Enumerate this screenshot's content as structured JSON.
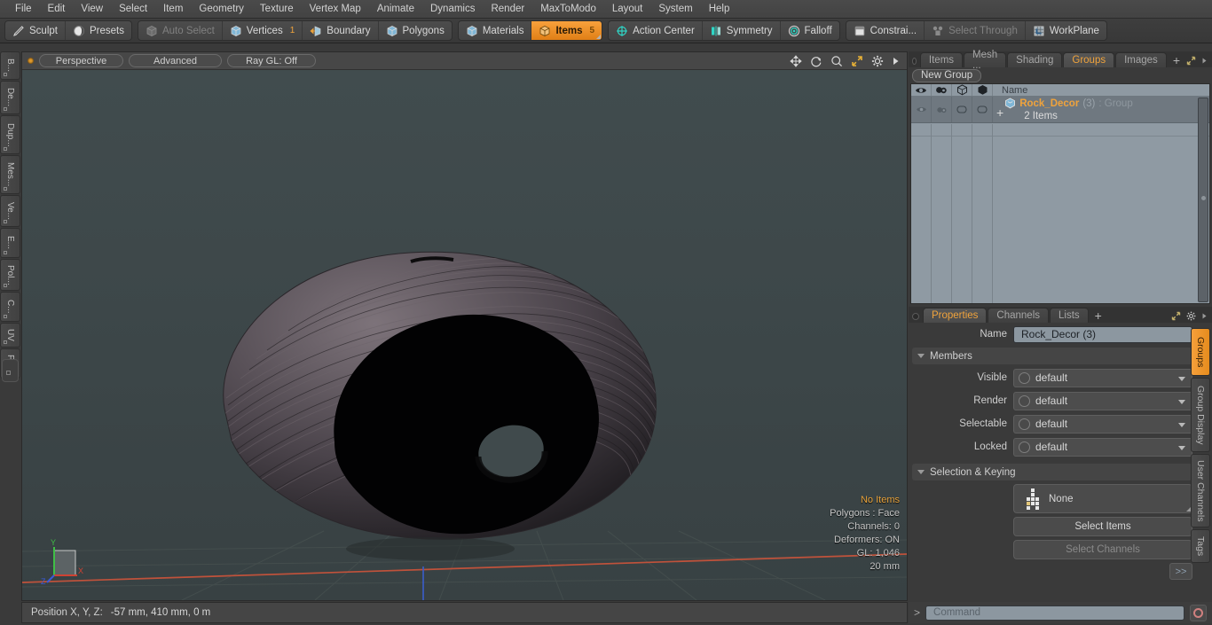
{
  "menu": {
    "items": [
      "File",
      "Edit",
      "View",
      "Select",
      "Item",
      "Geometry",
      "Texture",
      "Vertex Map",
      "Animate",
      "Dynamics",
      "Render",
      "MaxToModo",
      "Layout",
      "System",
      "Help"
    ]
  },
  "toolbar": {
    "groups": [
      {
        "buttons": [
          {
            "label": "Sculpt",
            "icon": "pencil-icon",
            "state": "normal"
          },
          {
            "label": "Presets",
            "icon": "sphere-icon",
            "state": "normal"
          }
        ]
      },
      {
        "buttons": [
          {
            "label": "Auto Select",
            "icon": "cube-grey-icon",
            "state": "disabled"
          },
          {
            "label": "Vertices",
            "icon": "cube-blue-icon",
            "state": "normal",
            "badge": "1"
          },
          {
            "label": "Boundary",
            "icon": "arrow-cube-icon",
            "state": "normal"
          },
          {
            "label": "Polygons",
            "icon": "cube-blue-icon",
            "state": "normal"
          }
        ]
      },
      {
        "buttons": [
          {
            "label": "Materials",
            "icon": "cube-blue-icon",
            "state": "normal"
          },
          {
            "label": "Items",
            "icon": "cube-orange-icon",
            "state": "active",
            "badge": "5"
          }
        ]
      },
      {
        "buttons": [
          {
            "label": "Action Center",
            "icon": "crosshair-icon",
            "state": "normal"
          },
          {
            "label": "Symmetry",
            "icon": "mirror-icon",
            "state": "normal"
          },
          {
            "label": "Falloff",
            "icon": "target-icon",
            "state": "normal"
          }
        ]
      },
      {
        "buttons": [
          {
            "label": "Constrai...",
            "icon": "constraint-icon",
            "state": "normal"
          },
          {
            "label": "Select Through",
            "icon": "through-icon",
            "state": "disabled"
          },
          {
            "label": "WorkPlane",
            "icon": "workplane-icon",
            "state": "normal"
          }
        ]
      }
    ]
  },
  "left_tabs": [
    "B...",
    "De...",
    "Dup...",
    "Mes...",
    "Ve...",
    "E...",
    "Pol...",
    "C...",
    "UV",
    "Fu..."
  ],
  "viewport": {
    "header": {
      "pills": [
        "Perspective",
        "Advanced",
        "Ray GL: Off"
      ],
      "icons": [
        "move-icon",
        "rotate-icon",
        "zoom-icon",
        "fit-icon",
        "gear-icon",
        "play-icon"
      ]
    },
    "info": {
      "selection": "No Items",
      "lines": [
        "Polygons : Face",
        "Channels: 0",
        "Deformers: ON",
        "GL: 1,046",
        "20 mm"
      ]
    },
    "axis_gizmo": {
      "x": "X",
      "y": "Y",
      "z": "Z"
    },
    "colors": {
      "bg_top": "#3f4a4c",
      "bg_bottom": "#394244",
      "x_axis": "#c0513a",
      "z_axis": "#3a5bc0",
      "grid": "#4a5456"
    }
  },
  "statusbar": {
    "label": "Position X, Y, Z:",
    "value": "-57 mm, 410 mm, 0 m"
  },
  "right_panel": {
    "top_tabs": [
      {
        "label": "Items",
        "selected": false
      },
      {
        "label": "Mesh ...",
        "selected": false
      },
      {
        "label": "Shading",
        "selected": false
      },
      {
        "label": "Groups",
        "selected": true
      },
      {
        "label": "Images",
        "selected": false
      }
    ],
    "top_tabs_add": "+",
    "new_group_button": "New Group",
    "group_list": {
      "columns": [
        "eye-icon",
        "render-icon",
        "cube-outline-icon",
        "cube-solid-icon"
      ],
      "name_header": "Name",
      "rows": [
        {
          "expander": "+",
          "icon": "group-cube-icon",
          "name": "Rock_Decor",
          "count": "(3)",
          "type": ": Group",
          "sub": "2 Items"
        }
      ]
    },
    "property_tabs": [
      {
        "label": "Properties",
        "selected": true
      },
      {
        "label": "Channels",
        "selected": false
      },
      {
        "label": "Lists",
        "selected": false
      }
    ],
    "property_tabs_add": "+",
    "properties": {
      "name_label": "Name",
      "name_value": "Rock_Decor (3)",
      "members_section": "Members",
      "members": [
        {
          "label": "Visible",
          "value": "default"
        },
        {
          "label": "Render",
          "value": "default"
        },
        {
          "label": "Selectable",
          "value": "default"
        },
        {
          "label": "Locked",
          "value": "default"
        }
      ],
      "selection_section": "Selection & Keying",
      "set_button": "None",
      "select_items_button": "Select Items",
      "select_channels_button": "Select Channels",
      "more_button": ">>"
    },
    "side_tabs": [
      {
        "label": "Groups",
        "selected": true
      },
      {
        "label": "Group Display",
        "selected": false
      },
      {
        "label": "User Channels",
        "selected": false
      },
      {
        "label": "Tags",
        "selected": false
      }
    ]
  },
  "command_bar": {
    "prompt": ">",
    "placeholder": "Command",
    "record_icon": "record-icon"
  },
  "theme": {
    "accent": "#f0a33c",
    "panel_bg": "#3a3a3a",
    "field_bg": "#8c97a0"
  }
}
